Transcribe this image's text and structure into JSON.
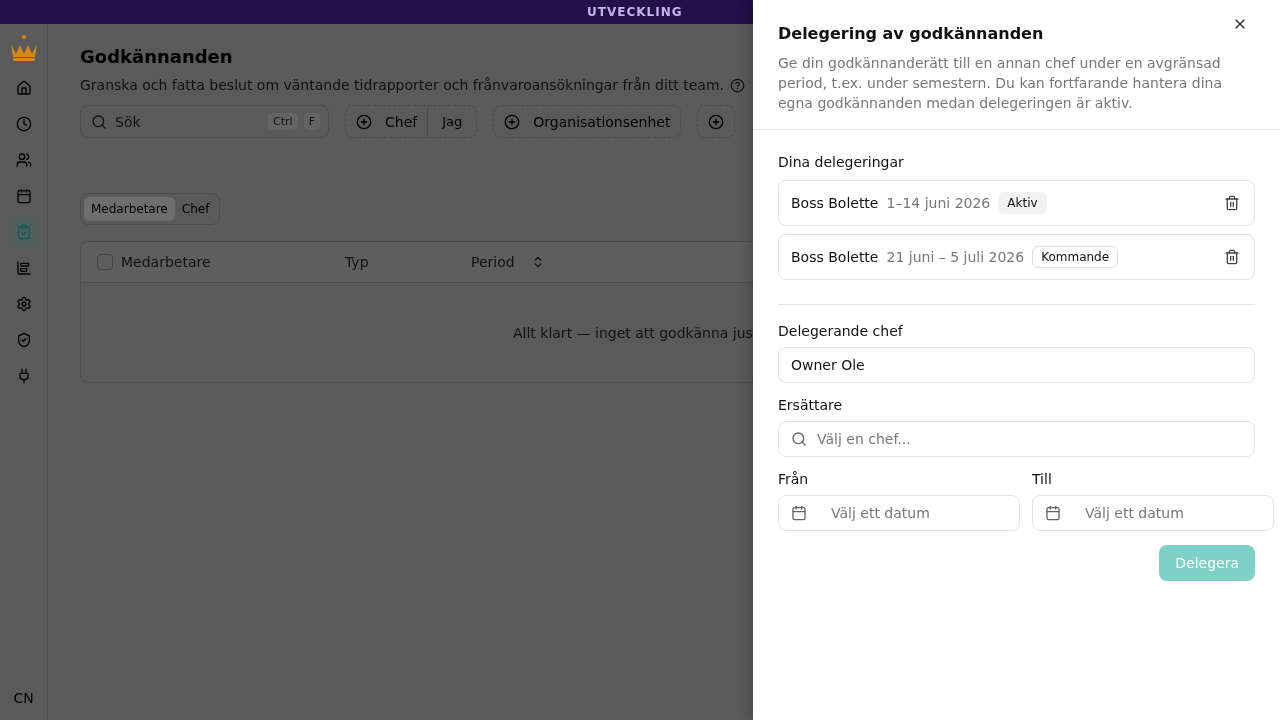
{
  "banner": {
    "label": "UTVECKLING"
  },
  "sidebar": {
    "items": [
      {
        "selected": false
      },
      {
        "selected": false
      },
      {
        "selected": false
      },
      {
        "selected": false
      },
      {
        "selected": true
      },
      {
        "selected": false
      },
      {
        "selected": false
      },
      {
        "selected": false
      },
      {
        "selected": false
      }
    ],
    "user_initials": "CN"
  },
  "page": {
    "title": "Godkännanden",
    "subtitle": "Granska och fatta beslut om väntande tidrapporter och frånvaroansökningar från ditt team.",
    "search": {
      "placeholder": "Sök",
      "shortcut": [
        "Ctrl",
        "F"
      ]
    },
    "filters": [
      {
        "kind": "labeled",
        "label": "Chef",
        "option": "Jag"
      },
      {
        "kind": "labeled",
        "label": "Organisationsenhet"
      },
      {
        "kind": "icon_only"
      }
    ],
    "view_toggle": [
      {
        "label": "Medarbetare",
        "selected": true
      },
      {
        "label": "Chef",
        "selected": false
      }
    ],
    "table": {
      "columns": [
        {
          "label": "Medarbetare",
          "kind": "checkbox",
          "checked": false
        },
        {
          "label": "Typ",
          "kind": "plain"
        },
        {
          "label": "Period",
          "kind": "sortable"
        }
      ],
      "empty_message": "Allt klart — inget att godkänna jus"
    }
  },
  "drawer": {
    "title": "Delegering av godkännanden",
    "description": "Ge din godkännanderätt till en annan chef under en avgränsad period, t.ex. under semestern. Du kan fortfarande hantera dina egna godkännanden medan delegeringen är aktiv.",
    "list_label": "Dina delegeringar",
    "delegations": [
      {
        "name": "Boss Bolette",
        "period": "1–14 juni 2026",
        "status": "Aktiv",
        "kind": "active"
      },
      {
        "name": "Boss Bolette",
        "period": "21 juni – 5 juli 2026",
        "status": "Kommande",
        "kind": "upcoming"
      }
    ],
    "form": {
      "manager_label": "Delegerande chef",
      "manager_value": "Owner Ole",
      "substitute_label": "Ersättare",
      "substitute_placeholder": "Välj en chef...",
      "from_label": "Från",
      "from_placeholder": "Välj ett datum",
      "to_label": "Till",
      "to_placeholder": "Välj ett datum",
      "submit": "Delegera",
      "submit_disabled": true
    }
  }
}
